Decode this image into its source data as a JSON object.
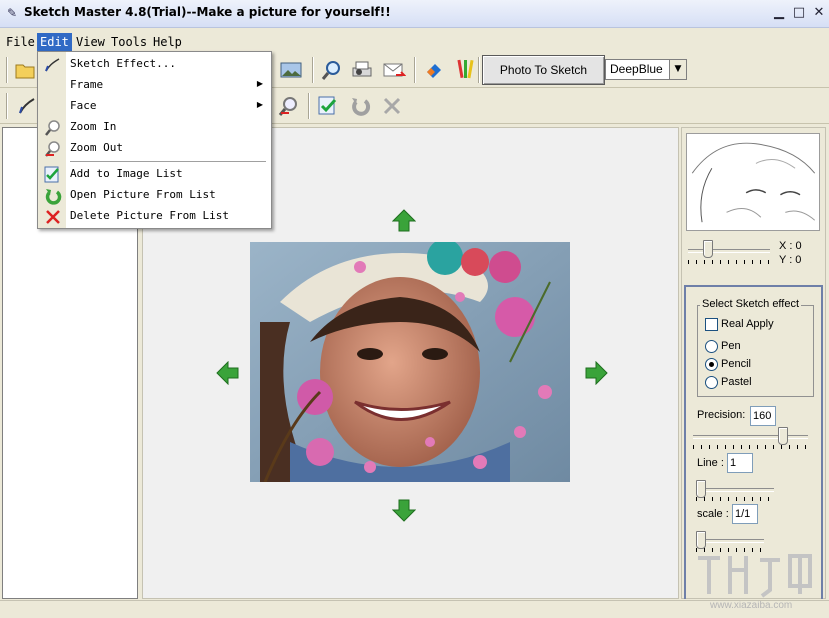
{
  "window": {
    "title": "Sketch Master 4.8(Trial)--Make a picture for yourself!!",
    "controls": [
      "minimize",
      "maximize",
      "close"
    ]
  },
  "menubar": {
    "items": [
      {
        "label": "File"
      },
      {
        "label": "Edit",
        "active": true
      },
      {
        "label": "View"
      },
      {
        "label": "Tools"
      },
      {
        "label": "Help"
      }
    ]
  },
  "edit_menu": {
    "items": [
      {
        "label": "Sketch  Effect...",
        "icon": "sketch-effect-icon",
        "submenu": false
      },
      {
        "label": "Frame",
        "icon": "",
        "submenu": true
      },
      {
        "label": "Face",
        "icon": "",
        "submenu": true
      },
      {
        "label": "Zoom In",
        "icon": "zoom-in-icon",
        "submenu": false
      },
      {
        "label": "Zoom Out",
        "icon": "zoom-out-icon",
        "submenu": false
      },
      {
        "label": "Add to Image List",
        "icon": "add-image-icon",
        "submenu": false
      },
      {
        "label": "Open Picture From List",
        "icon": "open-picture-icon",
        "submenu": false
      },
      {
        "label": "Delete Picture From List",
        "icon": "delete-picture-icon",
        "submenu": false
      }
    ]
  },
  "toolbar": {
    "photo_to_sketch_label": "Photo To Sketch",
    "color_scheme_value": "DeepBlue",
    "icons": [
      "open-icon",
      "picture-icon",
      "zoom-icon",
      "printer-icon",
      "email-icon",
      "eraser-icon",
      "palette-icon",
      "sketch-brush-icon",
      "zoom-out-icon",
      "add-image-icon",
      "undo-icon",
      "delete-icon"
    ]
  },
  "preview": {
    "x_label": "X : 0",
    "y_label": "Y : 0"
  },
  "sketch_effect": {
    "group_title": "Select Sketch effect",
    "real_apply_label": "Real Apply",
    "real_apply_checked": false,
    "options": [
      {
        "label": "Pen",
        "checked": false
      },
      {
        "label": "Pencil",
        "checked": true
      },
      {
        "label": "Pastel",
        "checked": false
      }
    ],
    "precision_label": "Precision:",
    "precision_value": "160",
    "line_label": "Line :",
    "line_value": "1",
    "scale_label": "scale :",
    "scale_value": "1/1"
  },
  "watermark": {
    "url_text": "www.xiazaiba.com"
  },
  "colors": {
    "menu_highlight": "#316ac5",
    "arrow_green": "#3aa33a"
  }
}
